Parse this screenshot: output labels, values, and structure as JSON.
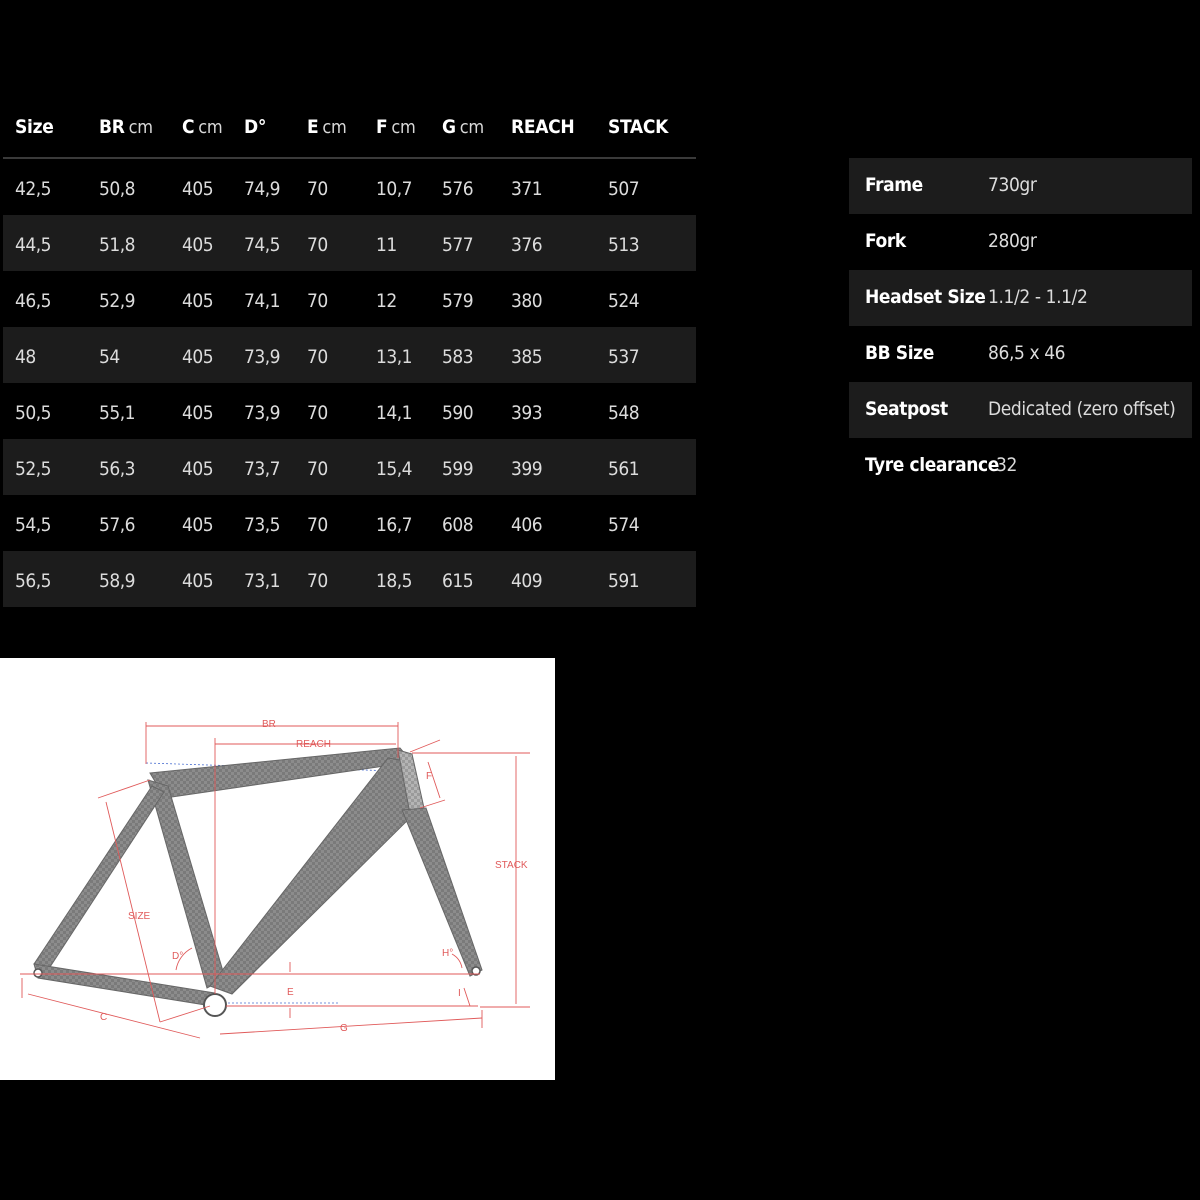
{
  "geometry": {
    "headers": [
      {
        "label": "Size",
        "unit": ""
      },
      {
        "label": "BR",
        "unit": "cm"
      },
      {
        "label": "C",
        "unit": "cm"
      },
      {
        "label": "D°",
        "unit": ""
      },
      {
        "label": "E",
        "unit": "cm"
      },
      {
        "label": "F",
        "unit": "cm"
      },
      {
        "label": "G",
        "unit": "cm"
      },
      {
        "label": "REACH",
        "unit": ""
      },
      {
        "label": "STACK",
        "unit": ""
      }
    ],
    "rows": [
      [
        "42,5",
        "50,8",
        "405",
        "74,9",
        "70",
        "10,7",
        "576",
        "371",
        "507"
      ],
      [
        "44,5",
        "51,8",
        "405",
        "74,5",
        "70",
        "11",
        "577",
        "376",
        "513"
      ],
      [
        "46,5",
        "52,9",
        "405",
        "74,1",
        "70",
        "12",
        "579",
        "380",
        "524"
      ],
      [
        "48",
        "54",
        "405",
        "73,9",
        "70",
        "13,1",
        "583",
        "385",
        "537"
      ],
      [
        "50,5",
        "55,1",
        "405",
        "73,9",
        "70",
        "14,1",
        "590",
        "393",
        "548"
      ],
      [
        "52,5",
        "56,3",
        "405",
        "73,7",
        "70",
        "15,4",
        "599",
        "399",
        "561"
      ],
      [
        "54,5",
        "57,6",
        "405",
        "73,5",
        "70",
        "16,7",
        "608",
        "406",
        "574"
      ],
      [
        "56,5",
        "58,9",
        "405",
        "73,1",
        "70",
        "18,5",
        "615",
        "409",
        "591"
      ]
    ]
  },
  "specs": [
    {
      "label": "Frame",
      "value": "730gr"
    },
    {
      "label": "Fork",
      "value": "280gr"
    },
    {
      "label": "Headset Size",
      "value": "1.1/2 - 1.1/2"
    },
    {
      "label": "BB Size",
      "value": "86,5 x 46"
    },
    {
      "label": "Seatpost",
      "value": "Dedicated (zero offset)"
    },
    {
      "label": "Tyre clearance",
      "value": "32"
    }
  ],
  "diagram": {
    "labels": {
      "br": "BR",
      "reach": "REACH",
      "f": "F",
      "stack": "STACK",
      "size": "SIZE",
      "d": "D°",
      "h": "H°",
      "e": "E",
      "c": "C",
      "g": "G",
      "i": "I"
    },
    "colors": {
      "dimension": "#e05a5a",
      "guide": "#4a6fd0",
      "frame": "#8a8a8a"
    }
  }
}
